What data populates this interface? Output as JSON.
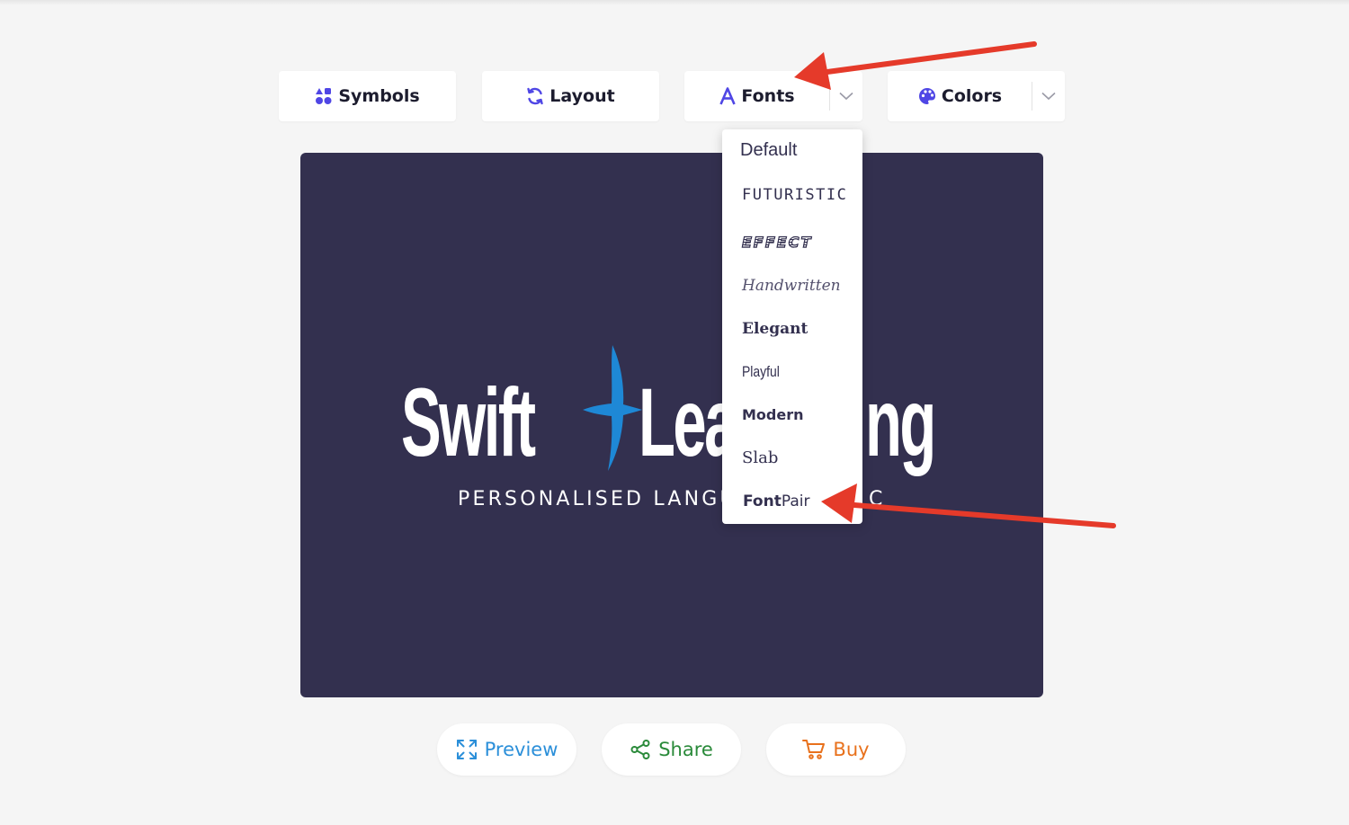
{
  "toolbar": {
    "symbols_label": "Symbols",
    "layout_label": "Layout",
    "fonts_label": "Fonts",
    "colors_label": "Colors"
  },
  "logo": {
    "word1": "Swift",
    "word2": "Lea",
    "word2_end": "ng",
    "tagline": "PERSONALISED LANGUA",
    "tagline_end": "C"
  },
  "fonts_menu": {
    "items": [
      "Default",
      "FUTURISTIC",
      "EFFECT",
      "Handwritten",
      "Elegant",
      "Playful",
      "Modern",
      "Slab",
      "Font",
      "Pair"
    ]
  },
  "actions": {
    "preview_label": "Preview",
    "share_label": "Share",
    "buy_label": "Buy"
  },
  "colors": {
    "canvas_bg": "#33304f",
    "accent_purple": "#4f46e5",
    "symbol_blue": "#1e88d6",
    "preview_blue": "#2b8fd9",
    "share_green": "#2a8a3a",
    "buy_orange": "#e8711c",
    "annotation_red": "#e53a2a"
  }
}
